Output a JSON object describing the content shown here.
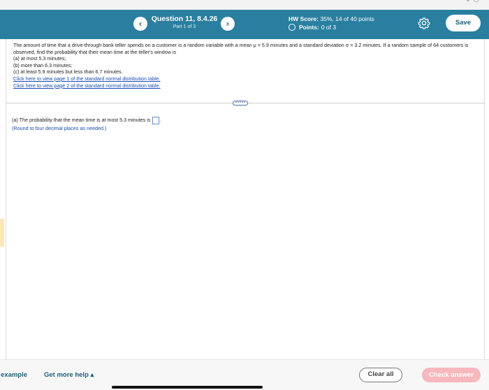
{
  "header": {
    "prev_icon": "‹",
    "next_icon": "›",
    "question_title": "Question 11, 8.4.26",
    "part": "Part 1 of 3",
    "hw_score_label": "HW Score:",
    "hw_score_value": "35%, 14 of 40 points",
    "points_label": "Points:",
    "points_value": "0 of 3",
    "save_label": "Save",
    "settings_icon": "gear-icon"
  },
  "problem": {
    "text": "The amount of time that a drive-through bank teller spends on a customer is a random variable with a mean μ = 5.9 minutes and a standard deviation σ = 3.2 minutes. If a random sample of 64 customers is observed, find the probability that their mean time at the teller's window is",
    "part_a": "(a) at most 5.3 minutes;",
    "part_b": "(b) more than 6.3 minutes;",
    "part_c": "(c) at least 5.9 minutes but less than 6.7 minutes.",
    "link1": "Click here to view page 1 of the standard normal distribution table.",
    "link2": "Click here to view page 2 of the standard normal distribution table."
  },
  "divider_handle": "•••••",
  "answer": {
    "prompt": "(a) The probability that the mean time is at most 5.3 minutes is",
    "suffix": ".",
    "round_note": "(Round to four decimal places as needed.)"
  },
  "footer": {
    "example_label": "example",
    "more_help_label": "Get more help ▴",
    "clear_label": "Clear all",
    "check_label": "Check answer"
  },
  "colors": {
    "header_bg": "#2a7fa0",
    "link": "#1a4db3",
    "check_button": "#f6b8bd"
  }
}
